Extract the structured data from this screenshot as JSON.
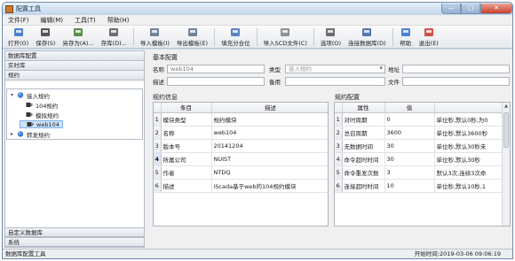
{
  "window": {
    "title": "配置工具",
    "controls": [
      "—",
      "□",
      "✕"
    ]
  },
  "menu": [
    "文件(F)",
    "编辑(M)",
    "工具(T)",
    "帮助(H)"
  ],
  "toolbar": [
    {
      "label": "打开(O)",
      "icon": "open-icon",
      "color": "#2f6fc2"
    },
    {
      "label": "保存(S)",
      "icon": "save-icon",
      "color": "#3a3a3a"
    },
    {
      "label": "另存为(A)...",
      "icon": "save-as-icon",
      "color": "#3d7a2c"
    },
    {
      "label": "存库(D)...",
      "icon": "save-db-icon",
      "color": "#555555"
    },
    {
      "label": "导入模板(I)",
      "icon": "import-template-icon",
      "color": "#5b6f8a"
    },
    {
      "label": "导出模板(E)",
      "icon": "export-template-icon",
      "color": "#5b6f8a"
    },
    {
      "label": "填充分合位",
      "icon": "fill-icon",
      "color": "#3f6fb8"
    },
    {
      "label": "导入SCD文件(C)",
      "icon": "import-scd-icon",
      "color": "#7b7f88"
    },
    {
      "label": "选项(O)",
      "icon": "options-icon",
      "color": "#555555"
    },
    {
      "label": "连接数据库(D)",
      "icon": "connect-db-icon",
      "color": "#3a5fa8"
    },
    {
      "label": "帮助",
      "icon": "help-icon",
      "color": "#2a6fd1"
    },
    {
      "label": "退出(E)",
      "icon": "exit-icon",
      "color": "#c8342b"
    }
  ],
  "nav": {
    "sections_top": [
      "数据库配置",
      "实时库",
      "规约"
    ],
    "tree": [
      {
        "label": "接入规约",
        "level": 0,
        "expanded": true,
        "icon": "globe-icon"
      },
      {
        "label": "104规约",
        "level": 1,
        "icon": "module-icon"
      },
      {
        "label": "模拟规约",
        "level": 1,
        "icon": "module-icon"
      },
      {
        "label": "web104",
        "level": 1,
        "icon": "module-icon",
        "selected": true
      },
      {
        "label": "转发规约",
        "level": 0,
        "icon": "globe-icon"
      }
    ],
    "sections_bottom": [
      "自定义数据库",
      "系统"
    ]
  },
  "basic": {
    "title": "基本配置",
    "name_label": "名称",
    "name_value": "web104",
    "type_label": "类型",
    "type_value": "接入规约",
    "address_label": "地址",
    "address_value": "",
    "desc_label": "描述",
    "desc_value": "",
    "note_label": "备用",
    "note_value": "",
    "file_label": "文件",
    "file_value": ""
  },
  "info": {
    "title": "规约信息",
    "headers": [
      "条目",
      "描述"
    ],
    "rows": [
      {
        "idx": "1",
        "key": "模块类型",
        "value": "规约模块"
      },
      {
        "idx": "2",
        "key": "名称",
        "value": "web104"
      },
      {
        "idx": "3",
        "key": "版本号",
        "value": "20141204"
      },
      {
        "idx": "4",
        "key": "所属公司",
        "value": "NUIST",
        "current": true
      },
      {
        "idx": "5",
        "key": "作者",
        "value": "NTDQ"
      },
      {
        "idx": "6",
        "key": "描述",
        "value": "iScada基于web的104规约模块"
      }
    ]
  },
  "config": {
    "title": "规约配置",
    "headers": [
      "属性",
      "值",
      ""
    ],
    "rows": [
      {
        "idx": "1",
        "key": "对时周期",
        "value": "0",
        "note": "单位秒,默认0秒,为0"
      },
      {
        "idx": "2",
        "key": "总召周期",
        "value": "3600",
        "note": "单位秒,默认3600秒"
      },
      {
        "idx": "3",
        "key": "无数据时间",
        "value": "30",
        "note": "单位秒,默认30秒未"
      },
      {
        "idx": "4",
        "key": "命令超时时间",
        "value": "30",
        "note": "单位秒,默认30秒"
      },
      {
        "idx": "5",
        "key": "命令重发次数",
        "value": "3",
        "note": "默认3次,连续3次命"
      },
      {
        "idx": "6",
        "key": "连接超时时间",
        "value": "10",
        "note": "单位秒,默认10秒,1"
      }
    ]
  },
  "status": {
    "left": "数据库配置工具",
    "right": "开始时间:2019-03-06 09:06:19"
  }
}
